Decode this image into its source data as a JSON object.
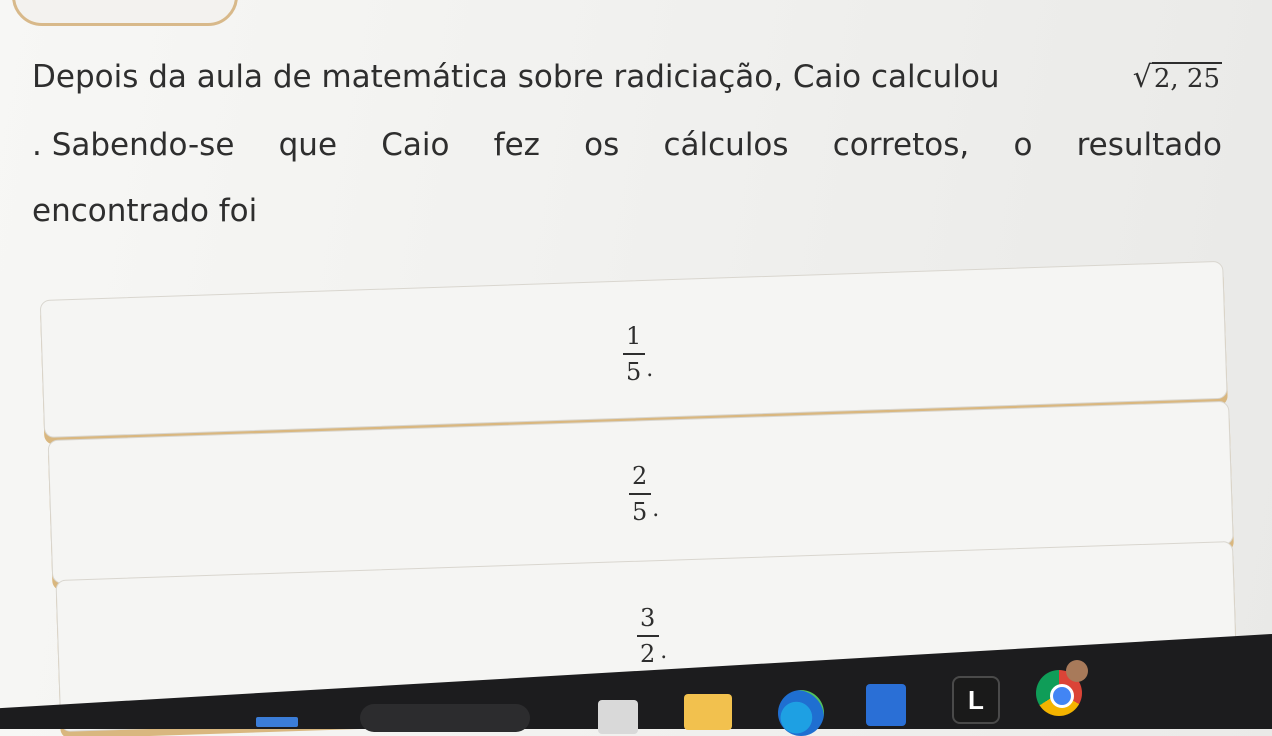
{
  "question": {
    "line1": "Depois da aula de matemática sobre radiciação, Caio calculou",
    "sqrt_symbol": "√",
    "sqrt_value": "2, 25",
    "line2_words": [
      ". Sabendo-se",
      "que",
      "Caio",
      "fez",
      "os",
      "cálculos",
      "corretos,",
      "o",
      "resultado"
    ],
    "line3": "encontrado foi"
  },
  "options": [
    {
      "numerator": "1",
      "denominator": "5",
      "suffix": "."
    },
    {
      "numerator": "2",
      "denominator": "5",
      "suffix": "."
    },
    {
      "numerator": "3",
      "denominator": "2",
      "suffix": "."
    }
  ],
  "taskbar": {
    "icons": [
      "windows-start-icon",
      "search-box",
      "task-view-icon",
      "file-explorer-icon",
      "edge-icon",
      "store-icon",
      "l-app-icon",
      "chrome-icon",
      "profile-avatar-icon"
    ],
    "l_app_label": "L"
  },
  "colors": {
    "option_border_accent": "#d9b77f",
    "background": "#f1f1ef",
    "taskbar": "#1c1c1e"
  }
}
